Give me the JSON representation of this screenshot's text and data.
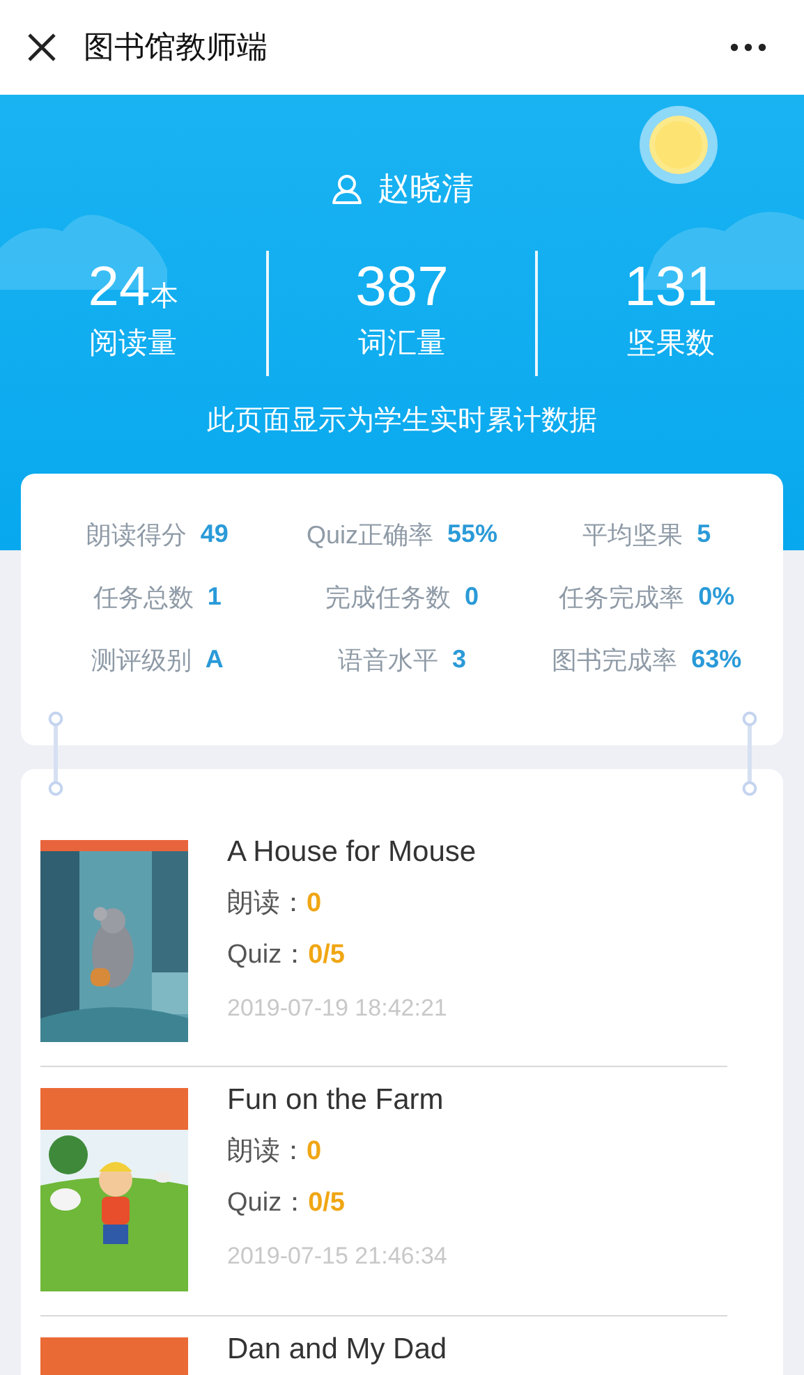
{
  "top_bar": {
    "title": "图书馆教师端"
  },
  "student": {
    "name": "赵晓清"
  },
  "summary": [
    {
      "value": "24",
      "unit": "本",
      "label": "阅读量"
    },
    {
      "value": "387",
      "label": "词汇量"
    },
    {
      "value": "131",
      "label": "坚果数"
    }
  ],
  "note": "此页面显示为学生实时累计数据",
  "metrics": [
    {
      "label": "朗读得分",
      "value": "49"
    },
    {
      "label": "Quiz正确率",
      "value": "55%"
    },
    {
      "label": "平均坚果",
      "value": "5"
    },
    {
      "label": "任务总数",
      "value": "1"
    },
    {
      "label": "完成任务数",
      "value": "0"
    },
    {
      "label": "任务完成率",
      "value": "0%"
    },
    {
      "label": "测评级别",
      "value": "A"
    },
    {
      "label": "语音水平",
      "value": "3"
    },
    {
      "label": "图书完成率",
      "value": "63%"
    }
  ],
  "books": [
    {
      "title": "A House for Mouse",
      "reading_label": "朗读：",
      "reading": "0",
      "quiz_label": "Quiz：",
      "quiz": "0/5",
      "time": "2019-07-19 18:42:21"
    },
    {
      "title": "Fun on the Farm",
      "reading_label": "朗读：",
      "reading": "0",
      "quiz_label": "Quiz：",
      "quiz": "0/5",
      "time": "2019-07-15 21:46:34"
    },
    {
      "title": "Dan and My Dad"
    }
  ]
}
